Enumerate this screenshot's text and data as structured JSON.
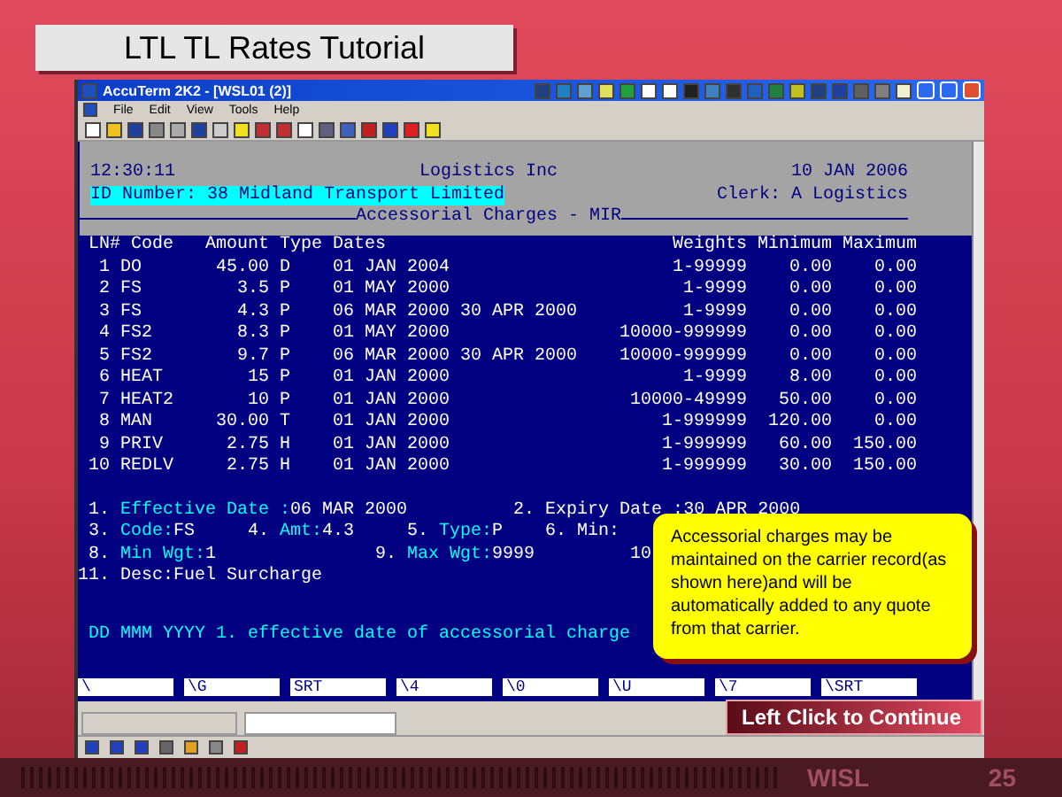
{
  "slide": {
    "title": "LTL TL Rates Tutorial",
    "footer_label": "WISL",
    "page_number": "25"
  },
  "window": {
    "title": "AccuTerm 2K2 - [WSL01 (2)]",
    "menu": [
      "File",
      "Edit",
      "View",
      "Tools",
      "Help"
    ]
  },
  "terminal": {
    "time": "12:30:11",
    "company": "Logistics Inc",
    "date": "10 JAN 2006",
    "id_line": "ID Number: 38 Midland Transport Limited",
    "clerk": "Clerk: A Logistics",
    "screen_title": "Accessorial Charges - MIR",
    "columns": [
      "LN#",
      "Code",
      "Amount",
      "Type",
      "Dates",
      "Weights",
      "Minimum",
      "Maximum"
    ],
    "rows": [
      {
        "ln": "1",
        "code": "DO",
        "amount": "45.00",
        "type": "D",
        "start_date": "01 JAN 2004",
        "weights": "1-99999",
        "minimum": "0.00",
        "maximum": "0.00"
      },
      {
        "ln": "2",
        "code": "FS",
        "amount": "3.5",
        "type": "P",
        "start_date": "01 MAY 2000",
        "weights": "1-9999",
        "minimum": "0.00",
        "maximum": "0.00"
      },
      {
        "ln": "3",
        "code": "FS",
        "amount": "4.3",
        "type": "P",
        "start_date": "06 MAR 2000",
        "end_date": "30 APR 2000",
        "weights": "1-9999",
        "minimum": "0.00",
        "maximum": "0.00"
      },
      {
        "ln": "4",
        "code": "FS2",
        "amount": "8.3",
        "type": "P",
        "start_date": "01 MAY 2000",
        "weights": "10000-999999",
        "minimum": "0.00",
        "maximum": "0.00"
      },
      {
        "ln": "5",
        "code": "FS2",
        "amount": "9.7",
        "type": "P",
        "start_date": "06 MAR 2000",
        "end_date": "30 APR 2000",
        "weights": "10000-999999",
        "minimum": "0.00",
        "maximum": "0.00"
      },
      {
        "ln": "6",
        "code": "HEAT",
        "amount": "15",
        "type": "P",
        "start_date": "01 JAN 2000",
        "weights": "1-9999",
        "minimum": "8.00",
        "maximum": "0.00"
      },
      {
        "ln": "7",
        "code": "HEAT2",
        "amount": "10",
        "type": "P",
        "start_date": "01 JAN 2000",
        "weights": "10000-49999",
        "minimum": "50.00",
        "maximum": "0.00"
      },
      {
        "ln": "8",
        "code": "MAN",
        "amount": "30.00",
        "type": "T",
        "start_date": "01 JAN 2000",
        "weights": "1-999999",
        "minimum": "120.00",
        "maximum": "0.00"
      },
      {
        "ln": "9",
        "code": "PRIV",
        "amount": "2.75",
        "type": "H",
        "start_date": "01 JAN 2000",
        "weights": "1-999999",
        "minimum": "60.00",
        "maximum": "150.00"
      },
      {
        "ln": "10",
        "code": "REDLV",
        "amount": "2.75",
        "type": "H",
        "start_date": "01 JAN 2000",
        "weights": "1-999999",
        "minimum": "30.00",
        "maximum": "150.00"
      }
    ],
    "fields": [
      [
        {
          "number": "1.",
          "label": "Effective Date :",
          "value": "06 MAR 2000",
          "editable": true
        },
        {
          "number": "2.",
          "label": "Expiry Date :",
          "value": "30 APR 2000",
          "editable": false
        }
      ],
      [
        {
          "number": "3.",
          "label": "Code:",
          "value": "FS",
          "editable": true
        },
        {
          "number": "4.",
          "label": "Amt:",
          "value": "4.3",
          "editable": true
        },
        {
          "number": "5.",
          "label": "Type:",
          "value": "P",
          "editable": true
        },
        {
          "number": "6.",
          "label": "Min:",
          "editable": false
        }
      ],
      [
        {
          "number": "8.",
          "label": "Min Wgt:",
          "value": "1",
          "editable": true
        },
        {
          "number": "9.",
          "label": "Max Wgt:",
          "value": "9999",
          "editable": true
        },
        {
          "number": "10"
        }
      ],
      [
        {
          "number": "11.",
          "label": "Desc:",
          "value": "Fuel Surcharge",
          "editable": false
        }
      ]
    ],
    "help_line": "DD MMM YYYY 1. effective date of accessorial charge",
    "function_keys": [
      "\\",
      "\\G",
      "SRT",
      "\\4",
      "\\0",
      "\\U",
      "\\7",
      "\\SRT"
    ]
  },
  "callout": {
    "text": "Accessorial charges may be maintained on the carrier record(as shown here)and will be automatically added to any quote from that carrier."
  },
  "continue_button": {
    "label": "Left Click to Continue"
  }
}
